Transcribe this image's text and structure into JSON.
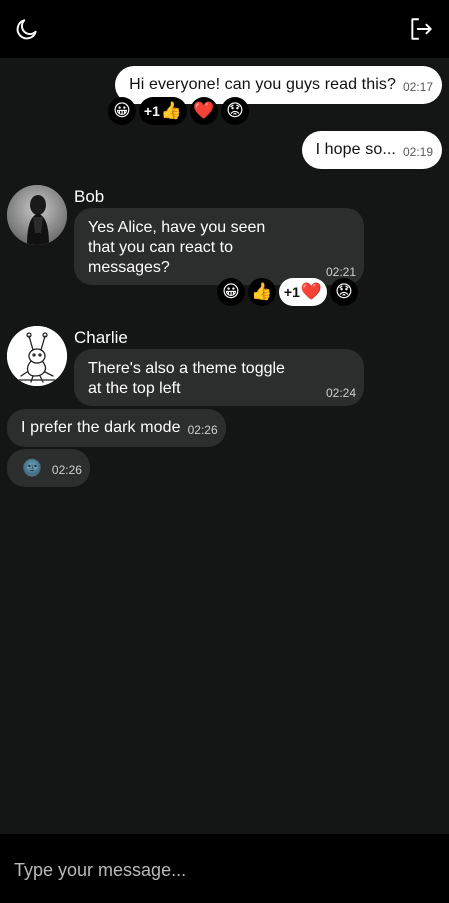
{
  "header": {
    "theme_toggle_icon": "moon-icon",
    "logout_icon": "logout-icon"
  },
  "messages": [
    {
      "text": "Hi everyone! can you guys read this?",
      "time": "02:17",
      "reactions": [
        {
          "emoji": "😀"
        },
        {
          "count": "+1",
          "emoji": "👍"
        },
        {
          "emoji": "❤️"
        },
        {
          "emoji": "😟"
        }
      ]
    },
    {
      "text": "I hope so...",
      "time": "02:19"
    },
    {
      "sender": "Bob",
      "text": "Yes Alice, have you seen that you can react to messages?",
      "lines": [
        "Yes Alice, have you seen",
        "that you can react to",
        "messages?"
      ],
      "time": "02:21",
      "reactions": [
        {
          "emoji": "😀"
        },
        {
          "emoji": "👍"
        },
        {
          "count": "+1",
          "emoji": "❤️",
          "selected": true
        },
        {
          "emoji": "😟"
        }
      ]
    },
    {
      "sender": "Charlie",
      "text": "There's also a theme toggle at the top left",
      "lines": [
        "There's also a theme toggle",
        "at the top left"
      ],
      "time": "02:24"
    },
    {
      "text": "I prefer the dark mode",
      "time": "02:26"
    },
    {
      "emoji": "🌚",
      "time": "02:26"
    }
  ],
  "composer": {
    "placeholder": "Type your message..."
  }
}
